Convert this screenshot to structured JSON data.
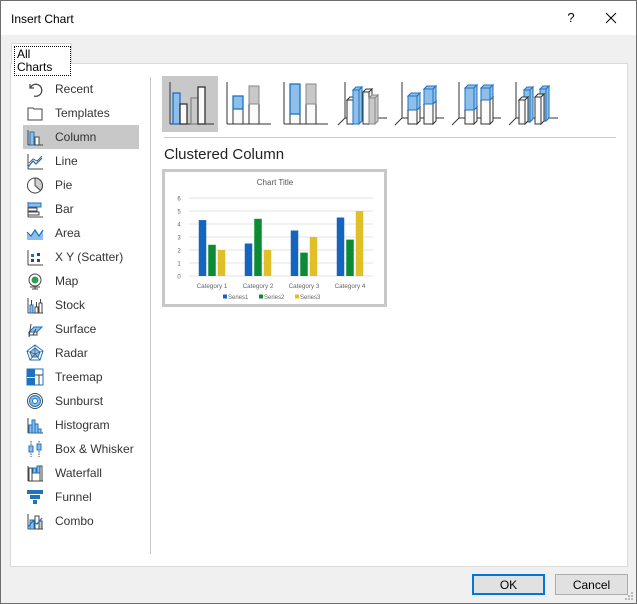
{
  "window": {
    "title": "Insert Chart",
    "help_label": "?",
    "close_icon": "close-icon"
  },
  "tabs": [
    {
      "label": "All Charts",
      "selected": true
    }
  ],
  "sidebar": {
    "items": [
      {
        "label": "Recent",
        "icon": "recent-icon"
      },
      {
        "label": "Templates",
        "icon": "templates-icon"
      },
      {
        "label": "Column",
        "icon": "column-chart-icon",
        "selected": true
      },
      {
        "label": "Line",
        "icon": "line-chart-icon"
      },
      {
        "label": "Pie",
        "icon": "pie-chart-icon"
      },
      {
        "label": "Bar",
        "icon": "bar-chart-icon"
      },
      {
        "label": "Area",
        "icon": "area-chart-icon"
      },
      {
        "label": "X Y (Scatter)",
        "icon": "scatter-chart-icon"
      },
      {
        "label": "Map",
        "icon": "map-chart-icon"
      },
      {
        "label": "Stock",
        "icon": "stock-chart-icon"
      },
      {
        "label": "Surface",
        "icon": "surface-chart-icon"
      },
      {
        "label": "Radar",
        "icon": "radar-chart-icon"
      },
      {
        "label": "Treemap",
        "icon": "treemap-chart-icon"
      },
      {
        "label": "Sunburst",
        "icon": "sunburst-chart-icon"
      },
      {
        "label": "Histogram",
        "icon": "histogram-chart-icon"
      },
      {
        "label": "Box & Whisker",
        "icon": "box-whisker-chart-icon"
      },
      {
        "label": "Waterfall",
        "icon": "waterfall-chart-icon"
      },
      {
        "label": "Funnel",
        "icon": "funnel-chart-icon"
      },
      {
        "label": "Combo",
        "icon": "combo-chart-icon"
      }
    ]
  },
  "subtypes": [
    {
      "name": "clustered-column",
      "selected": true
    },
    {
      "name": "stacked-column"
    },
    {
      "name": "100-stacked-column"
    },
    {
      "name": "3d-clustered-column"
    },
    {
      "name": "3d-stacked-column"
    },
    {
      "name": "3d-100-stacked-column"
    },
    {
      "name": "3d-column"
    }
  ],
  "selected_subtype_title": "Clustered Column",
  "colors": {
    "accent": "#0078d7",
    "icon_blue": "#1e73be",
    "icon_fill": "#8ebfea",
    "selected_bg": "#c8c8c8",
    "series1": "#1565c0",
    "series2": "#0d8a36",
    "series3": "#e0bf28"
  },
  "chart_data": {
    "type": "bar",
    "title": "Chart Title",
    "categories": [
      "Category 1",
      "Category 2",
      "Category 3",
      "Category 4"
    ],
    "series": [
      {
        "name": "Series1",
        "values": [
          4.3,
          2.5,
          3.5,
          4.5
        ]
      },
      {
        "name": "Series2",
        "values": [
          2.4,
          4.4,
          1.8,
          2.8
        ]
      },
      {
        "name": "Series3",
        "values": [
          2,
          2,
          3,
          5
        ]
      }
    ],
    "yticks": [
      "0",
      "1",
      "2",
      "3",
      "4",
      "5",
      "6"
    ],
    "ylim": [
      0,
      6
    ],
    "grid": true,
    "legend": "bottom",
    "xlabel": "",
    "ylabel": ""
  },
  "footer": {
    "ok_label": "OK",
    "cancel_label": "Cancel"
  }
}
